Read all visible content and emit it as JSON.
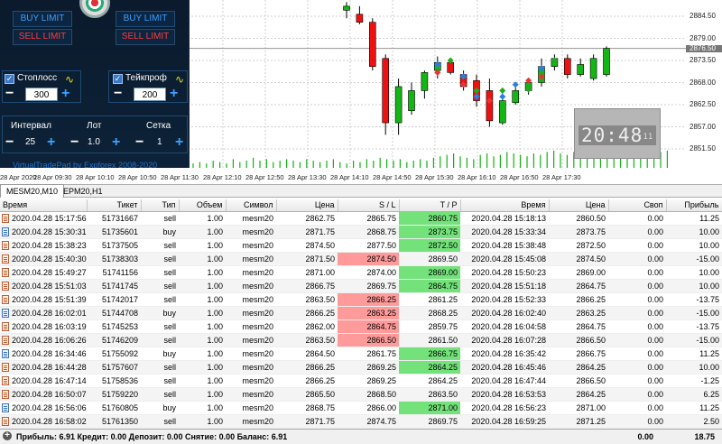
{
  "pad": {
    "buy_limit_left": "BUY LIMIT",
    "sell_limit_left": "SELL LIMIT",
    "buy_limit_right": "BUY LIMIT",
    "sell_limit_right": "SELL LIMIT",
    "stoploss_label": "Стоплосс",
    "stoploss_value": "300",
    "takeprofit_label": "Тейкпроф",
    "takeprofit_value": "200",
    "interval_label": "Интервал",
    "interval_value": "25",
    "lot_label": "Лот",
    "lot_value": "1.0",
    "grid_label": "Сетка",
    "grid_value": "1",
    "footer": "VirtualTradePad by Expforex 2008-2020"
  },
  "clock": {
    "time": "20:48",
    "seconds": ":11"
  },
  "chart_data": {
    "type": "candlestick",
    "price_labels": [
      "2884.50",
      "2879.00",
      "2876.50",
      "2873.50",
      "2868.00",
      "2862.50",
      "2857.00",
      "2851.50"
    ],
    "current_price": "2876.50",
    "time_labels": [
      "28 Apr 2020",
      "28 Apr 09:30",
      "28 Apr 10:10",
      "28 Apr 10:50",
      "28 Apr 11:30",
      "28 Apr 12:10",
      "28 Apr 12:50",
      "28 Apr 13:30",
      "28 Apr 14:10",
      "28 Apr 14:50",
      "28 Apr 15:30",
      "28 Apr 16:10",
      "28 Apr 16:50",
      "28 Apr 17:30"
    ],
    "candles": [
      {
        "o": 2886.0,
        "h": 2888.0,
        "l": 2884.0,
        "c": 2887.0
      },
      {
        "o": 2885.0,
        "h": 2887.0,
        "l": 2882.5,
        "c": 2883.0
      },
      {
        "o": 2883.0,
        "h": 2884.0,
        "l": 2871.0,
        "c": 2872.0
      },
      {
        "o": 2874.0,
        "h": 2875.0,
        "l": 2855.0,
        "c": 2858.0
      },
      {
        "o": 2858.0,
        "h": 2869.0,
        "l": 2855.0,
        "c": 2867.0
      },
      {
        "o": 2861.0,
        "h": 2868.0,
        "l": 2860.0,
        "c": 2866.0
      },
      {
        "o": 2866.0,
        "h": 2871.0,
        "l": 2864.0,
        "c": 2870.5
      },
      {
        "o": 2871.0,
        "h": 2874.5,
        "l": 2869.0,
        "c": 2873.0
      },
      {
        "o": 2873.0,
        "h": 2874.0,
        "l": 2870.0,
        "c": 2870.5
      },
      {
        "o": 2870.0,
        "h": 2871.0,
        "l": 2866.0,
        "c": 2867.0
      },
      {
        "o": 2868.5,
        "h": 2870.0,
        "l": 2862.0,
        "c": 2863.5
      },
      {
        "o": 2866.0,
        "h": 2869.0,
        "l": 2857.0,
        "c": 2858.5
      },
      {
        "o": 2858.0,
        "h": 2866.0,
        "l": 2857.5,
        "c": 2863.5
      },
      {
        "o": 2863.0,
        "h": 2867.0,
        "l": 2862.5,
        "c": 2866.0
      },
      {
        "o": 2866.0,
        "h": 2869.0,
        "l": 2865.0,
        "c": 2868.0
      },
      {
        "o": 2868.0,
        "h": 2874.0,
        "l": 2867.0,
        "c": 2872.0
      },
      {
        "o": 2872.0,
        "h": 2875.0,
        "l": 2871.0,
        "c": 2874.0
      },
      {
        "o": 2874.0,
        "h": 2875.0,
        "l": 2869.0,
        "c": 2870.0
      },
      {
        "o": 2870.0,
        "h": 2874.0,
        "l": 2869.5,
        "c": 2872.5
      },
      {
        "o": 2869.0,
        "h": 2875.0,
        "l": 2868.5,
        "c": 2874.0
      },
      {
        "o": 2870.0,
        "h": 2877.0,
        "l": 2869.5,
        "c": 2876.5
      }
    ],
    "volumes": [
      3,
      4,
      3,
      5,
      4,
      3,
      6,
      4,
      5,
      7,
      5,
      6,
      4,
      5,
      6,
      5,
      4,
      6,
      5,
      4,
      5,
      6,
      4,
      3,
      5,
      4,
      6,
      5,
      7,
      6,
      5,
      6,
      4,
      5,
      6,
      5,
      7,
      8,
      9,
      10,
      8,
      7,
      6,
      9,
      10,
      8,
      9,
      11,
      10,
      9,
      8,
      10,
      9,
      11,
      12,
      10,
      9,
      11,
      12,
      10,
      11,
      12,
      13,
      11,
      12,
      10,
      11,
      12,
      10,
      9,
      11,
      12
    ]
  },
  "tabs": [
    {
      "label": "MESM20,M10"
    },
    {
      "label": "EPM20,H1"
    }
  ],
  "table": {
    "headers": [
      "Время",
      "Тикет",
      "Тип",
      "Объем",
      "Символ",
      "Цена",
      "S / L",
      "T / P",
      "Время",
      "Цена",
      "Своп",
      "Прибыль"
    ],
    "rows": [
      {
        "time": "2020.04.28 15:17:56",
        "ticket": "51731667",
        "type": "sell",
        "volume": "1.00",
        "symbol": "mesm20",
        "price": "2862.75",
        "sl": "2865.75",
        "tp": "2860.75",
        "time2": "2020.04.28 15:18:13",
        "price2": "2860.50",
        "swap": "0.00",
        "profit": "11.25",
        "sl_hl": "",
        "tp_hl": "green"
      },
      {
        "time": "2020.04.28 15:30:31",
        "ticket": "51735601",
        "type": "buy",
        "volume": "1.00",
        "symbol": "mesm20",
        "price": "2871.75",
        "sl": "2868.75",
        "tp": "2873.75",
        "time2": "2020.04.28 15:33:34",
        "price2": "2873.75",
        "swap": "0.00",
        "profit": "10.00",
        "sl_hl": "",
        "tp_hl": "green"
      },
      {
        "time": "2020.04.28 15:38:23",
        "ticket": "51737505",
        "type": "sell",
        "volume": "1.00",
        "symbol": "mesm20",
        "price": "2874.50",
        "sl": "2877.50",
        "tp": "2872.50",
        "time2": "2020.04.28 15:38:48",
        "price2": "2872.50",
        "swap": "0.00",
        "profit": "10.00",
        "sl_hl": "",
        "tp_hl": "green"
      },
      {
        "time": "2020.04.28 15:40:30",
        "ticket": "51738303",
        "type": "sell",
        "volume": "1.00",
        "symbol": "mesm20",
        "price": "2871.50",
        "sl": "2874.50",
        "tp": "2869.50",
        "time2": "2020.04.28 15:45:08",
        "price2": "2874.50",
        "swap": "0.00",
        "profit": "-15.00",
        "sl_hl": "red",
        "tp_hl": ""
      },
      {
        "time": "2020.04.28 15:49:27",
        "ticket": "51741156",
        "type": "sell",
        "volume": "1.00",
        "symbol": "mesm20",
        "price": "2871.00",
        "sl": "2874.00",
        "tp": "2869.00",
        "time2": "2020.04.28 15:50:23",
        "price2": "2869.00",
        "swap": "0.00",
        "profit": "10.00",
        "sl_hl": "",
        "tp_hl": "green"
      },
      {
        "time": "2020.04.28 15:51:03",
        "ticket": "51741745",
        "type": "sell",
        "volume": "1.00",
        "symbol": "mesm20",
        "price": "2866.75",
        "sl": "2869.75",
        "tp": "2864.75",
        "time2": "2020.04.28 15:51:18",
        "price2": "2864.75",
        "swap": "0.00",
        "profit": "10.00",
        "sl_hl": "",
        "tp_hl": "green"
      },
      {
        "time": "2020.04.28 15:51:39",
        "ticket": "51742017",
        "type": "sell",
        "volume": "1.00",
        "symbol": "mesm20",
        "price": "2863.50",
        "sl": "2866.25",
        "tp": "2861.25",
        "time2": "2020.04.28 15:52:33",
        "price2": "2866.25",
        "swap": "0.00",
        "profit": "-13.75",
        "sl_hl": "red",
        "tp_hl": ""
      },
      {
        "time": "2020.04.28 16:02:01",
        "ticket": "51744708",
        "type": "buy",
        "volume": "1.00",
        "symbol": "mesm20",
        "price": "2866.25",
        "sl": "2863.25",
        "tp": "2868.25",
        "time2": "2020.04.28 16:02:40",
        "price2": "2863.25",
        "swap": "0.00",
        "profit": "-15.00",
        "sl_hl": "red",
        "tp_hl": ""
      },
      {
        "time": "2020.04.28 16:03:19",
        "ticket": "51745253",
        "type": "sell",
        "volume": "1.00",
        "symbol": "mesm20",
        "price": "2862.00",
        "sl": "2864.75",
        "tp": "2859.75",
        "time2": "2020.04.28 16:04:58",
        "price2": "2864.75",
        "swap": "0.00",
        "profit": "-13.75",
        "sl_hl": "red",
        "tp_hl": ""
      },
      {
        "time": "2020.04.28 16:06:26",
        "ticket": "51746209",
        "type": "sell",
        "volume": "1.00",
        "symbol": "mesm20",
        "price": "2863.50",
        "sl": "2866.50",
        "tp": "2861.50",
        "time2": "2020.04.28 16:07:28",
        "price2": "2866.50",
        "swap": "0.00",
        "profit": "-15.00",
        "sl_hl": "red",
        "tp_hl": ""
      },
      {
        "time": "2020.04.28 16:34:46",
        "ticket": "51755092",
        "type": "buy",
        "volume": "1.00",
        "symbol": "mesm20",
        "price": "2864.50",
        "sl": "2861.75",
        "tp": "2866.75",
        "time2": "2020.04.28 16:35:42",
        "price2": "2866.75",
        "swap": "0.00",
        "profit": "11.25",
        "sl_hl": "",
        "tp_hl": "green"
      },
      {
        "time": "2020.04.28 16:44:28",
        "ticket": "51757607",
        "type": "sell",
        "volume": "1.00",
        "symbol": "mesm20",
        "price": "2866.25",
        "sl": "2869.25",
        "tp": "2864.25",
        "time2": "2020.04.28 16:45:46",
        "price2": "2864.25",
        "swap": "0.00",
        "profit": "10.00",
        "sl_hl": "",
        "tp_hl": "green"
      },
      {
        "time": "2020.04.28 16:47:14",
        "ticket": "51758536",
        "type": "sell",
        "volume": "1.00",
        "symbol": "mesm20",
        "price": "2866.25",
        "sl": "2869.25",
        "tp": "2864.25",
        "time2": "2020.04.28 16:47:44",
        "price2": "2866.50",
        "swap": "0.00",
        "profit": "-1.25",
        "sl_hl": "",
        "tp_hl": ""
      },
      {
        "time": "2020.04.28 16:50:07",
        "ticket": "51759220",
        "type": "sell",
        "volume": "1.00",
        "symbol": "mesm20",
        "price": "2865.50",
        "sl": "2868.50",
        "tp": "2863.50",
        "time2": "2020.04.28 16:53:53",
        "price2": "2864.25",
        "swap": "0.00",
        "profit": "6.25",
        "sl_hl": "",
        "tp_hl": ""
      },
      {
        "time": "2020.04.28 16:56:06",
        "ticket": "51760805",
        "type": "buy",
        "volume": "1.00",
        "symbol": "mesm20",
        "price": "2868.75",
        "sl": "2866.00",
        "tp": "2871.00",
        "time2": "2020.04.28 16:56:23",
        "price2": "2871.00",
        "swap": "0.00",
        "profit": "11.25",
        "sl_hl": "",
        "tp_hl": "green"
      },
      {
        "time": "2020.04.28 16:58:02",
        "ticket": "51761350",
        "type": "sell",
        "volume": "1.00",
        "symbol": "mesm20",
        "price": "2871.75",
        "sl": "2874.75",
        "tp": "2869.75",
        "time2": "2020.04.28 16:59:25",
        "price2": "2871.25",
        "swap": "0.00",
        "profit": "2.50",
        "sl_hl": "",
        "tp_hl": ""
      }
    ]
  },
  "status": {
    "summary": "Прибыль: 6.91  Кредит: 0.00  Депозит: 0.00  Снятие: 0.00  Баланс: 6.91",
    "swap_total": "0.00",
    "profit_total": "18.75"
  }
}
